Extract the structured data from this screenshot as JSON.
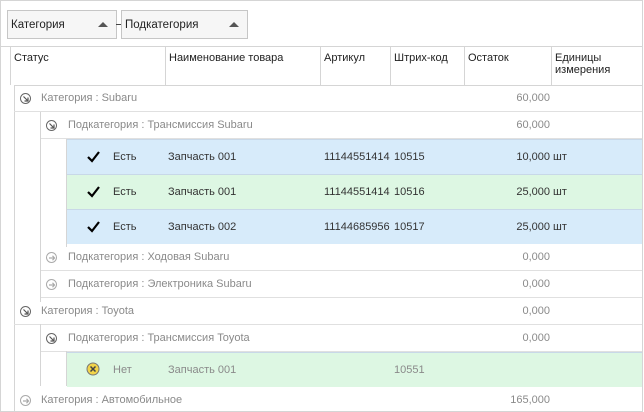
{
  "group_panel": {
    "fields": [
      {
        "label": "Категория"
      },
      {
        "label": "Подкатегория"
      }
    ]
  },
  "columns": {
    "status": "Статус",
    "name": "Наименование товара",
    "article": "Артикул",
    "barcode": "Штрих-код",
    "stock": "Остаток",
    "units": "Единицы измерения"
  },
  "rows": [
    {
      "kind": "group",
      "level": 1,
      "text": "Категория : Subaru",
      "stock": "60,000",
      "expanded": true
    },
    {
      "kind": "group",
      "level": 2,
      "text": "Подкатегория : Трансмиссия Subaru",
      "stock": "60,000",
      "expanded": true
    },
    {
      "kind": "data",
      "style": "blue",
      "status_icon": "check-icon",
      "status": "Есть",
      "name": "Запчасть 001",
      "article": "11144551414",
      "barcode": "10515",
      "stock": "10,000",
      "units": "шт"
    },
    {
      "kind": "data",
      "style": "green",
      "status_icon": "check-icon",
      "status": "Есть",
      "name": "Запчасть 001",
      "article": "11144551414",
      "barcode": "10516",
      "stock": "25,000",
      "units": "шт"
    },
    {
      "kind": "data",
      "style": "blue",
      "status_icon": "check-icon",
      "status": "Есть",
      "name": "Запчасть 002",
      "article": "11144685956",
      "barcode": "10517",
      "stock": "25,000",
      "units": "шт"
    },
    {
      "kind": "group",
      "level": 2,
      "text": "Подкатегория : Ходовая Subaru",
      "stock": "0,000",
      "expanded": false
    },
    {
      "kind": "group",
      "level": 2,
      "text": "Подкатегория : Электроника Subaru",
      "stock": "0,000",
      "expanded": false
    },
    {
      "kind": "group",
      "level": 1,
      "text": "Категория : Toyota",
      "stock": "0,000",
      "expanded": true
    },
    {
      "kind": "group",
      "level": 2,
      "text": "Подкатегория : Трансмиссия Toyota",
      "stock": "0,000",
      "expanded": true
    },
    {
      "kind": "data",
      "style": "green",
      "status_icon": "cross-circle-icon",
      "status": "Нет",
      "name": "Запчасть 001",
      "article": "",
      "barcode": "10551",
      "stock": "",
      "units": "",
      "dim": true
    },
    {
      "kind": "group",
      "level": 1,
      "text": "Категория : Автомобильное",
      "stock": "165,000",
      "expanded": false
    }
  ],
  "colors": {
    "row_blue": "#d7ebfa",
    "row_green": "#ddf7e3",
    "check": "#000000",
    "cross_fill": "#f2d44a"
  }
}
